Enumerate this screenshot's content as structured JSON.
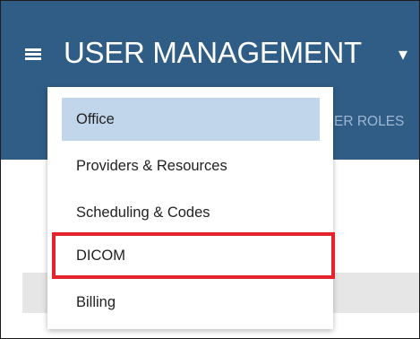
{
  "header": {
    "menu_icon": "hamburger-menu-icon",
    "title": "USER MANAGEMENT",
    "dropdown_icon": "caret-down-icon",
    "caret_glyph": "▾"
  },
  "tabs": [
    {
      "label": "ER ROLES"
    }
  ],
  "dropdown": {
    "items": [
      {
        "label": "Office",
        "selected": true
      },
      {
        "label": "Providers & Resources"
      },
      {
        "label": "Scheduling & Codes"
      },
      {
        "label": "DICOM",
        "highlighted": true
      },
      {
        "label": "Billing"
      }
    ]
  },
  "colors": {
    "header_bg": "#2f5d86",
    "selected_item_bg": "#c1d6ea",
    "highlight_border": "#e6222c",
    "tab_text": "#9fb7d1"
  }
}
